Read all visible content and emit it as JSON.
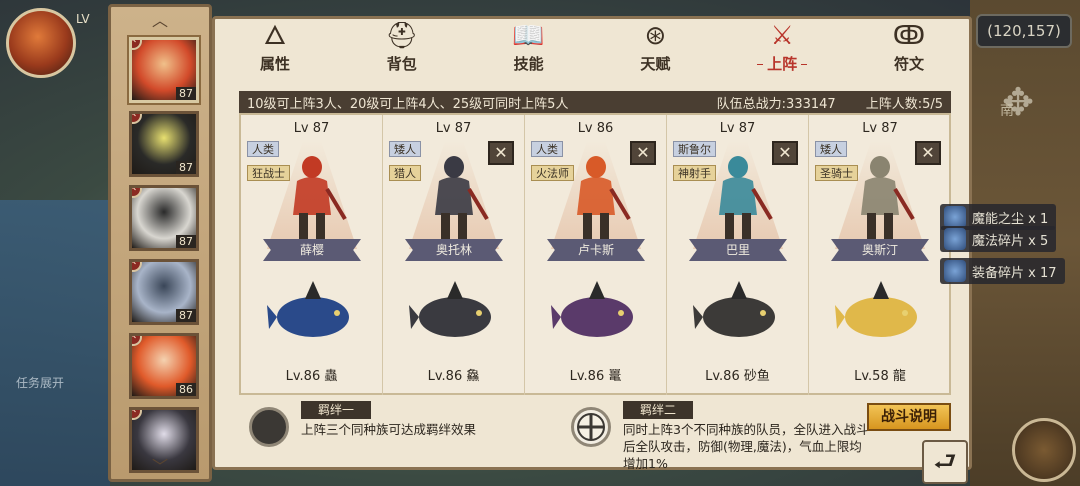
{
  "top_left": {
    "level_text": "LV"
  },
  "coords": "(120,157)",
  "map_label": "南",
  "quest_label": "任务展开",
  "char_list": {
    "items": [
      {
        "level": "87",
        "active": true,
        "colors": [
          "#d24a2a",
          "#f0c08a"
        ]
      },
      {
        "level": "87",
        "active": false,
        "colors": [
          "#2a2a28",
          "#e8e070"
        ]
      },
      {
        "level": "87",
        "active": false,
        "colors": [
          "#d8d6d0",
          "#2a2a2a"
        ]
      },
      {
        "level": "87",
        "active": false,
        "colors": [
          "#a8b4c8",
          "#3a4658"
        ]
      },
      {
        "level": "86",
        "active": false,
        "colors": [
          "#e05a2a",
          "#f4d2b0"
        ]
      },
      {
        "level": "",
        "active": false,
        "colors": [
          "#3a3840",
          "#e0dce8"
        ]
      }
    ]
  },
  "tabs": [
    {
      "label": "属性",
      "icon": "🜂",
      "active": false
    },
    {
      "label": "背包",
      "icon": "⛑",
      "active": false
    },
    {
      "label": "技能",
      "icon": "📖",
      "active": false
    },
    {
      "label": "天赋",
      "icon": "⊛",
      "active": false
    },
    {
      "label": "上阵",
      "icon": "⚔",
      "active": true
    },
    {
      "label": "符文",
      "icon": "ↂ",
      "active": false
    }
  ],
  "info_bar": {
    "rule": "10级可上阵3人、20级可上阵4人、25级可同时上阵5人",
    "power": "队伍总战力:333147",
    "count": "上阵人数:5/5"
  },
  "slots": [
    {
      "level": "Lv 87",
      "race": "人类",
      "job": "狂战士",
      "name": "薛樱",
      "pet": "Lv.86 蟲",
      "removable": false,
      "hero_color": "#c23a24",
      "pet_color": "#2a4a8a"
    },
    {
      "level": "Lv 87",
      "race": "矮人",
      "job": "猎人",
      "name": "奥托林",
      "pet": "Lv.86 鱻",
      "removable": true,
      "hero_color": "#3a3a44",
      "pet_color": "#3a3a40"
    },
    {
      "level": "Lv 86",
      "race": "人类",
      "job": "火法师",
      "name": "卢卡斯",
      "pet": "Lv.86 鼍",
      "removable": true,
      "hero_color": "#d85a28",
      "pet_color": "#5a3a6a"
    },
    {
      "level": "Lv 87",
      "race": "斯鲁尔",
      "job": "神射手",
      "name": "巴里",
      "pet": "Lv.86 砂鱼",
      "removable": true,
      "hero_color": "#3a8a9a",
      "pet_color": "#3c3a38"
    },
    {
      "level": "Lv 87",
      "race": "矮人",
      "job": "圣骑士",
      "name": "奥斯汀",
      "pet": "Lv.58 龍",
      "removable": true,
      "hero_color": "#8a8470",
      "pet_color": "#e0b84a"
    }
  ],
  "bonds": [
    {
      "title": "羁绊一",
      "desc": "上阵三个同种族可达成羁绊效果"
    },
    {
      "title": "羁绊二",
      "desc": "同时上阵3个不同种族的队员，全队进入战斗后全队攻击，防御(物理,魔法)，气血上限均增加1%"
    }
  ],
  "battle_button": "战斗说明",
  "drops": [
    {
      "label": "魔能之尘 x 1"
    },
    {
      "label": "魔法碎片 x 5"
    },
    {
      "label": "装备碎片 x 17"
    }
  ]
}
